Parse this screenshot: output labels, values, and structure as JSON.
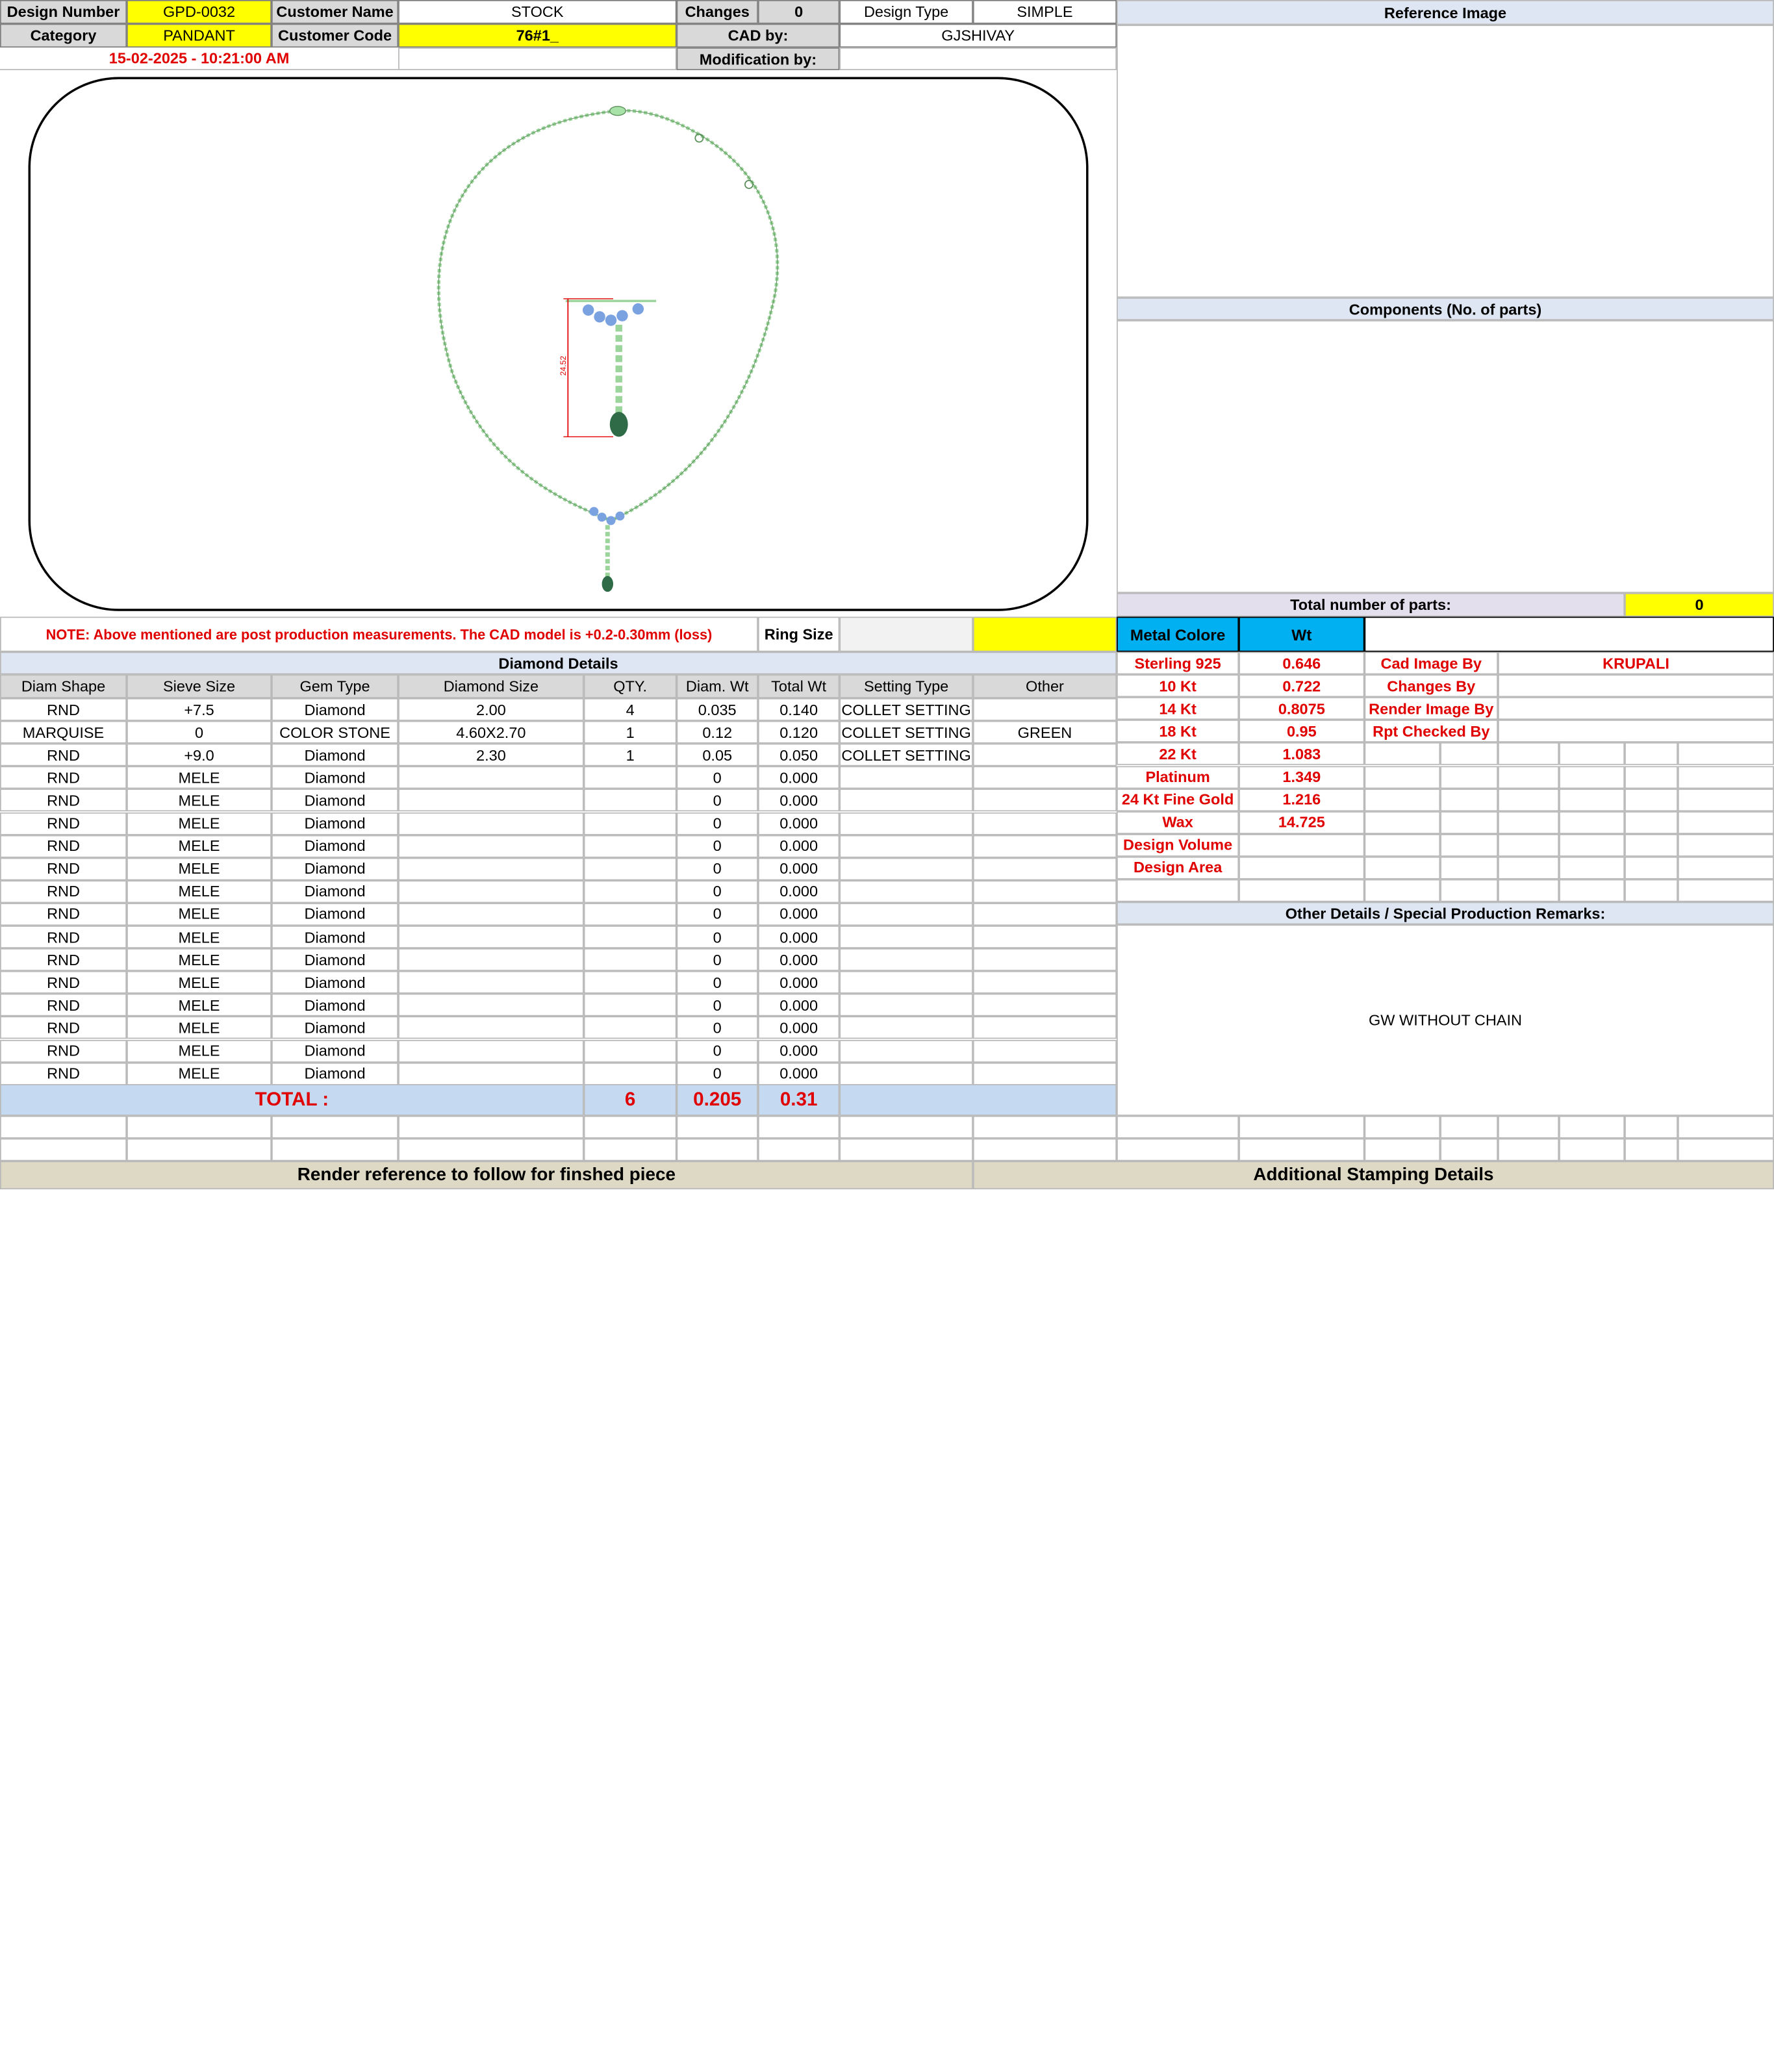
{
  "header": {
    "design_number_label": "Design Number",
    "design_number": "GPD-0032",
    "customer_name_label": "Customer Name",
    "customer_name": "STOCK",
    "changes_label": "Changes",
    "changes": "0",
    "design_type_label": "Design Type",
    "design_type": "SIMPLE",
    "category_label": "Category",
    "category": "PANDANT",
    "customer_code_label": "Customer Code",
    "customer_code": "76#1_",
    "cad_by_label": "CAD by:",
    "cad_by": "GJSHIVAY",
    "timestamp": "15-02-2025 - 10:21:00 AM",
    "modification_by_label": "Modification by:"
  },
  "render": {
    "dimension_label": "24.52"
  },
  "note": "NOTE: Above mentioned are post production measurements. The CAD model is +0.2-0.30mm (loss)",
  "ring_size_label": "Ring Size",
  "diamond": {
    "title": "Diamond Details",
    "columns": [
      "Diam Shape",
      "Sieve Size",
      "Gem Type",
      "Diamond Size",
      "QTY.",
      "Diam. Wt",
      "Total Wt",
      "Setting Type",
      "Other"
    ],
    "rows": [
      [
        "RND",
        "+7.5",
        "Diamond",
        "2.00",
        "4",
        "0.035",
        "0.140",
        "COLLET SETTING",
        ""
      ],
      [
        "MARQUISE",
        "0",
        "COLOR STONE",
        "4.60X2.70",
        "1",
        "0.12",
        "0.120",
        "COLLET SETTING",
        "GREEN"
      ],
      [
        "RND",
        "+9.0",
        "Diamond",
        "2.30",
        "1",
        "0.05",
        "0.050",
        "COLLET SETTING",
        ""
      ],
      [
        "RND",
        "MELE",
        "Diamond",
        "",
        "",
        "0",
        "0.000",
        "",
        ""
      ],
      [
        "RND",
        "MELE",
        "Diamond",
        "",
        "",
        "0",
        "0.000",
        "",
        ""
      ],
      [
        "RND",
        "MELE",
        "Diamond",
        "",
        "",
        "0",
        "0.000",
        "",
        ""
      ],
      [
        "RND",
        "MELE",
        "Diamond",
        "",
        "",
        "0",
        "0.000",
        "",
        ""
      ],
      [
        "RND",
        "MELE",
        "Diamond",
        "",
        "",
        "0",
        "0.000",
        "",
        ""
      ],
      [
        "RND",
        "MELE",
        "Diamond",
        "",
        "",
        "0",
        "0.000",
        "",
        ""
      ],
      [
        "RND",
        "MELE",
        "Diamond",
        "",
        "",
        "0",
        "0.000",
        "",
        ""
      ],
      [
        "RND",
        "MELE",
        "Diamond",
        "",
        "",
        "0",
        "0.000",
        "",
        ""
      ],
      [
        "RND",
        "MELE",
        "Diamond",
        "",
        "",
        "0",
        "0.000",
        "",
        ""
      ],
      [
        "RND",
        "MELE",
        "Diamond",
        "",
        "",
        "0",
        "0.000",
        "",
        ""
      ],
      [
        "RND",
        "MELE",
        "Diamond",
        "",
        "",
        "0",
        "0.000",
        "",
        ""
      ],
      [
        "RND",
        "MELE",
        "Diamond",
        "",
        "",
        "0",
        "0.000",
        "",
        ""
      ],
      [
        "RND",
        "MELE",
        "Diamond",
        "",
        "",
        "0",
        "0.000",
        "",
        ""
      ],
      [
        "RND",
        "MELE",
        "Diamond",
        "",
        "",
        "0",
        "0.000",
        "",
        ""
      ]
    ],
    "total_label": "TOTAL :",
    "total_qty": "6",
    "total_diam_wt": "0.205",
    "total_wt": "0.31"
  },
  "right": {
    "reference_title": "Reference Image",
    "components_title": "Components (No. of parts)",
    "total_parts_label": "Total number of parts:",
    "total_parts": "0",
    "metal_color_label": "Metal Colore",
    "wt_label": "Wt",
    "metals": [
      {
        "name": "Sterling 925",
        "wt": "0.646"
      },
      {
        "name": "10 Kt",
        "wt": "0.722"
      },
      {
        "name": "14 Kt",
        "wt": "0.8075"
      },
      {
        "name": "18 Kt",
        "wt": "0.95"
      },
      {
        "name": "22 Kt",
        "wt": "1.083"
      },
      {
        "name": "Platinum",
        "wt": "1.349"
      },
      {
        "name": "24 Kt Fine Gold",
        "wt": "1.216"
      },
      {
        "name": "Wax",
        "wt": "14.725"
      },
      {
        "name": "Design Volume",
        "wt": ""
      },
      {
        "name": "Design Area",
        "wt": ""
      }
    ],
    "credits": [
      {
        "label": "Cad Image By",
        "value": "KRUPALI"
      },
      {
        "label": "Changes By",
        "value": ""
      },
      {
        "label": "Render Image By",
        "value": ""
      },
      {
        "label": "Rpt Checked By",
        "value": ""
      }
    ],
    "remarks_title": "Other Details / Special Production Remarks:",
    "remarks": "GW WITHOUT CHAIN"
  },
  "footer": {
    "render_ref": "Render reference to follow for finshed piece",
    "stamping": "Additional Stamping Details"
  }
}
